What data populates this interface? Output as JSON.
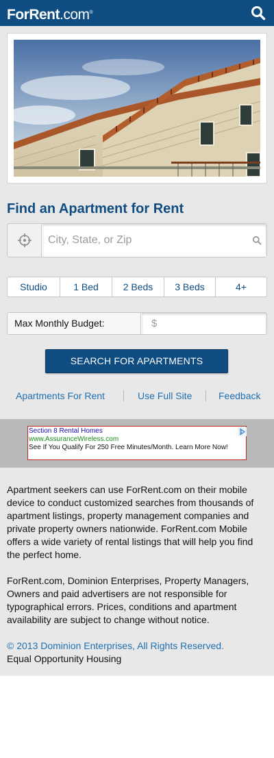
{
  "header": {
    "logo_main": "ForRent",
    "logo_suffix": ".com",
    "logo_mark": "®",
    "search_icon": "search-icon"
  },
  "hero": {
    "image": "apartment-building-photo"
  },
  "finder": {
    "title": "Find an Apartment for Rent",
    "location_placeholder": "City, State, or Zip",
    "location_value": "",
    "locate_icon": "crosshair-icon",
    "beds": [
      "Studio",
      "1 Bed",
      "2 Beds",
      "3 Beds",
      "4+"
    ],
    "budget_label": "Max Monthly Budget:",
    "budget_placeholder": "$",
    "search_button": "SEARCH FOR APARTMENTS"
  },
  "links": {
    "apartments_for_rent": "Apartments For Rent",
    "full_site": "Use Full Site",
    "feedback": "Feedback"
  },
  "ad": {
    "title": "Section 8 Rental Homes",
    "url": "www.AssuranceWireless.com",
    "text": "See If You Qualify For 250 Free Minutes/Month. Learn More Now!"
  },
  "footer": {
    "para1": "Apartment seekers can use ForRent.com on their mobile device to conduct customized searches from thousands of apartment listings, property management companies and private property owners nationwide. ForRent.com Mobile offers a wide variety of rental listings that will help you find the perfect home.",
    "para2": "ForRent.com, Dominion Enterprises, Property Managers, Owners and paid advertisers are not responsible for typographical errors. Prices, conditions and apartment availability are subject to change without notice.",
    "copyright": "© 2013 Dominion Enterprises, All Rights Reserved.",
    "equal_housing": "Equal Opportunity Housing"
  },
  "colors": {
    "brand": "#0f4c81",
    "link": "#1f6fb2",
    "panel": "#e8e8e8",
    "ad_band": "#b9b9b9"
  }
}
